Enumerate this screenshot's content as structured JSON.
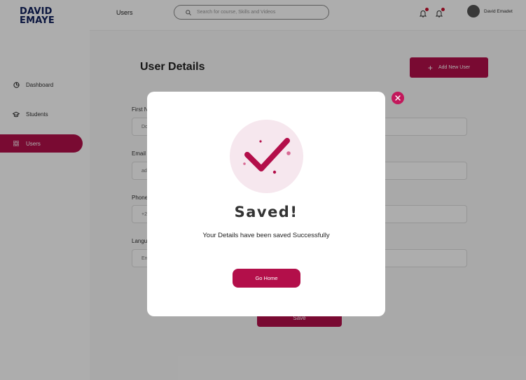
{
  "brand": {
    "line1": "DAVID",
    "line2": "EMAYE"
  },
  "sidebar": {
    "items": [
      {
        "label": "Dashboard",
        "icon": "pie-chart-icon"
      },
      {
        "label": "Students",
        "icon": "graduation-cap-icon"
      },
      {
        "label": "Users",
        "icon": "grid-icon",
        "active": true
      }
    ]
  },
  "topbar": {
    "title": "Users",
    "search_placeholder": "Search for course, Skills and Videos",
    "user_name": "David Emadet"
  },
  "page": {
    "title": "User Details",
    "add_button": "Add New User",
    "save_button": "Save"
  },
  "form": {
    "fields": [
      {
        "label": "First N",
        "value": "Do"
      },
      {
        "label": "Email",
        "value": "ad"
      },
      {
        "label": "Phone",
        "value": "+2"
      },
      {
        "label": "Langu",
        "value": "En"
      }
    ]
  },
  "modal": {
    "title": "Saved!",
    "message": "Your Details have been saved Successfully",
    "button": "Go Home"
  },
  "colors": {
    "accent": "#b30f4a",
    "brand_text": "#0f1f5c",
    "success_bg": "#f6e7ee"
  }
}
